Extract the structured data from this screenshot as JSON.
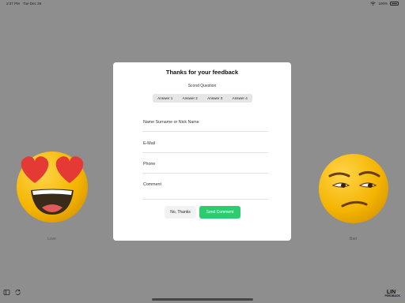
{
  "status": {
    "time": "2:37 PM",
    "date": "Tue Dec 29",
    "battery": "100%"
  },
  "background": {
    "left_emoji_label": "Love",
    "right_emoji_label": "Bad"
  },
  "modal": {
    "title": "Thanks for your feedback",
    "subtitle": "Scond Question",
    "answers": [
      "Answer 1",
      "Answer 2",
      "Answer 3",
      "Answer 4"
    ],
    "fields": {
      "name_placeholder": "Name Surname or Nick Name",
      "email_placeholder": "E-Mail",
      "phone_placeholder": "Phone",
      "comment_placeholder": "Comment"
    },
    "buttons": {
      "no_thanks": "No, Thanks",
      "send": "Send Comment"
    }
  },
  "logo": {
    "main_prefix": "LIN",
    "main_suffix": "...",
    "sub": "FEEDBACK"
  },
  "colors": {
    "overlay": "#8e8e8e",
    "send_button": "#2ecc71",
    "emoji": "#f4b400",
    "heart": "#e53935"
  },
  "icons": {
    "bottom_left_1": "sidebar-toggle-icon",
    "bottom_left_2": "rotate-icon"
  }
}
